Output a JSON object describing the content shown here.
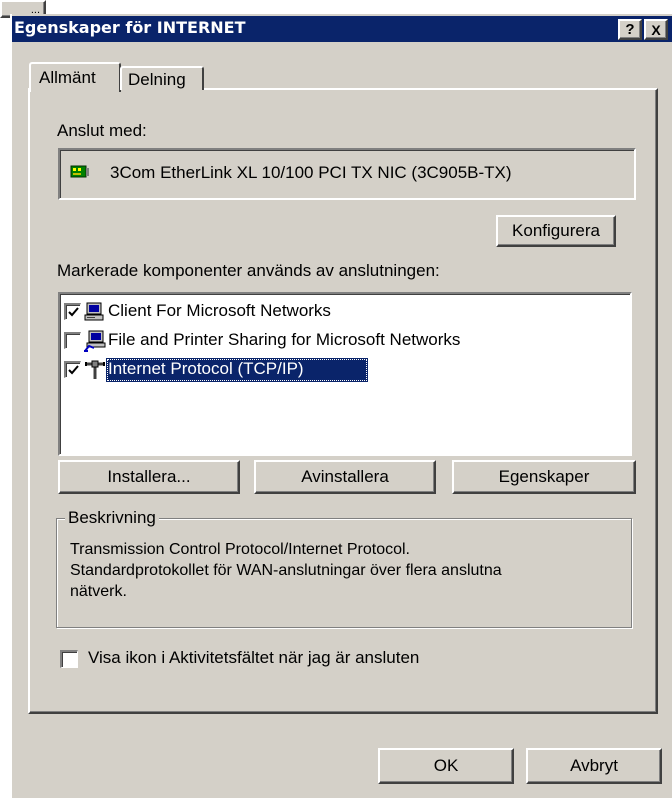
{
  "topbar": {
    "text": "..."
  },
  "window": {
    "title": "Egenskaper för INTERNET",
    "help_label": "?",
    "close_label": "X"
  },
  "tabs": [
    {
      "label": "Allmänt"
    },
    {
      "label": "Delning"
    }
  ],
  "connect": {
    "label": "Anslut med:",
    "adapter": "3Com EtherLink XL 10/100 PCI TX NIC (3C905B-TX)",
    "adapter_icon": "network-card-icon",
    "configure_label": "Konfigurera"
  },
  "components": {
    "label": "Markerade komponenter används av anslutningen:",
    "items": [
      {
        "label": "Client For Microsoft Networks",
        "checked": true,
        "icon": "client-computer-icon"
      },
      {
        "label": "File and Printer Sharing for Microsoft Networks",
        "checked": false,
        "icon": "file-printer-sharing-icon"
      },
      {
        "label": "Internet Protocol (TCP/IP)",
        "checked": true,
        "icon": "network-protocol-icon",
        "selected": true
      }
    ]
  },
  "actions": {
    "install": "Installera...",
    "uninstall": "Avinstallera",
    "properties": "Egenskaper"
  },
  "description": {
    "legend": "Beskrivning",
    "line1": "Transmission Control Protocol/Internet Protocol.",
    "line2": "Standardprotokollet för WAN-anslutningar över flera anslutna",
    "line3": "nätverk."
  },
  "show_icon": {
    "label": "Visa ikon i Aktivitetsfältet när jag är ansluten",
    "checked": false
  },
  "footer": {
    "ok": "OK",
    "cancel": "Avbryt"
  },
  "colors": {
    "title_bar": "#0a246a",
    "face": "#d4d0c8",
    "selection": "#0a246a"
  }
}
